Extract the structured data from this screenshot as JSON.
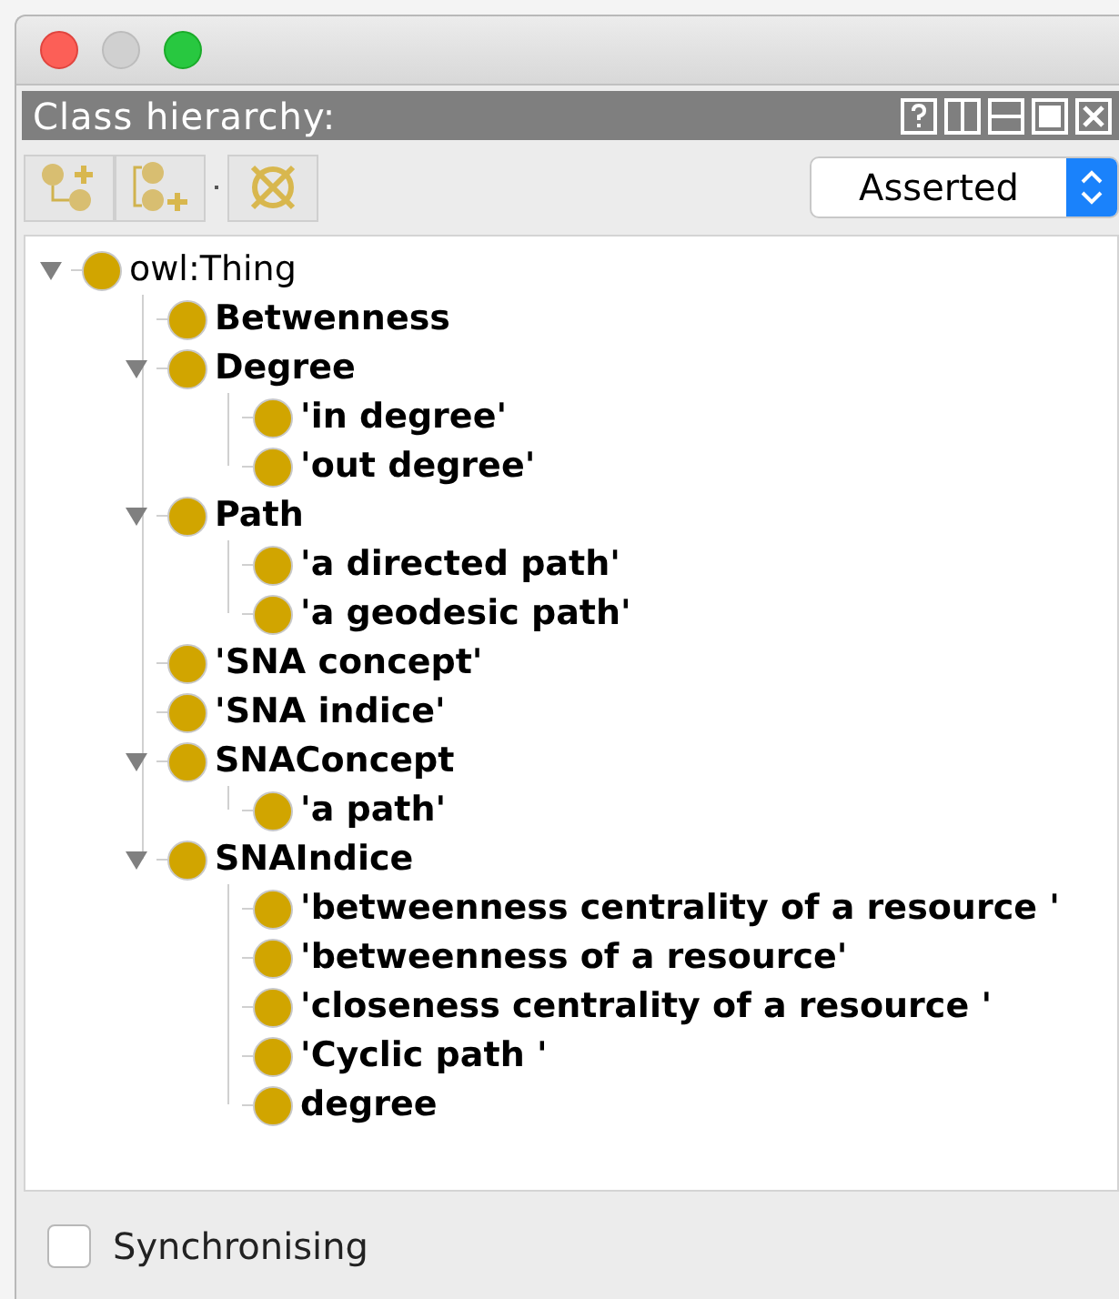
{
  "panel": {
    "title": "Class hierarchy:"
  },
  "view_select": {
    "value": "Asserted"
  },
  "tree": [
    {
      "label": "owl:Thing",
      "bold": false,
      "expanded": true,
      "children": [
        {
          "label": "Betwenness",
          "bold": true
        },
        {
          "label": "Degree",
          "bold": true,
          "expanded": true,
          "children": [
            {
              "label": "'in degree'",
              "bold": true
            },
            {
              "label": "'out degree'",
              "bold": true
            }
          ]
        },
        {
          "label": "Path",
          "bold": true,
          "expanded": true,
          "children": [
            {
              "label": "'a directed path'",
              "bold": true
            },
            {
              "label": "'a geodesic path'",
              "bold": true
            }
          ]
        },
        {
          "label": "'SNA concept'",
          "bold": true
        },
        {
          "label": "'SNA indice'",
          "bold": true
        },
        {
          "label": "SNAConcept",
          "bold": true,
          "expanded": true,
          "children": [
            {
              "label": "'a path'",
              "bold": true
            }
          ]
        },
        {
          "label": "SNAIndice",
          "bold": true,
          "expanded": true,
          "children": [
            {
              "label": "'betweenness centrality of a resource '",
              "bold": true
            },
            {
              "label": "'betweenness of a resource'",
              "bold": true
            },
            {
              "label": "'closeness centrality of a resource '",
              "bold": true
            },
            {
              "label": "'Cyclic path '",
              "bold": true
            },
            {
              "label": "degree",
              "bold": true
            }
          ]
        }
      ]
    }
  ],
  "sync": {
    "label": "Synchronising",
    "checked": false
  }
}
